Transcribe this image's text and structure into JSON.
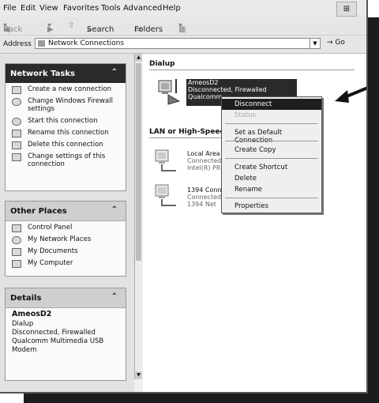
{
  "menubar": {
    "items": [
      "File",
      "Edit",
      "View",
      "Favorites",
      "Tools",
      "Advanced",
      "Help"
    ]
  },
  "toolbar": {
    "back": "Back",
    "search": "Search",
    "folders": "Folders"
  },
  "address": {
    "label": "Address",
    "value": "Network Connections",
    "go": "Go"
  },
  "network_tasks": {
    "title": "Network Tasks",
    "items": [
      "Create a new connection",
      "Change Windows Firewall settings",
      "Start this connection",
      "Rename this connection",
      "Delete this connection",
      "Change settings of this connection"
    ]
  },
  "other_places": {
    "title": "Other Places",
    "items": [
      "Control Panel",
      "My Network Places",
      "My Documents",
      "My Computer"
    ]
  },
  "details": {
    "title": "Details",
    "name": "AmeosD2",
    "lines": [
      "Dialup",
      "Disconnected, Firewalled",
      "Qualcomm Multimedia USB Modem"
    ]
  },
  "content": {
    "group_dialup": "Dialup",
    "group_lan": "LAN or High-Speed",
    "dialup_conn": {
      "name": "AmeosD2",
      "line2": "Disconnected, Firewalled",
      "line3": "Qualcomm"
    },
    "lan_conn1": {
      "name": "Local Area",
      "line2": "Connected",
      "line3": "Intel(R) PR"
    },
    "lan_conn2": {
      "name": "1394 Conn",
      "line2": "Connected",
      "line3": "1394 Net"
    }
  },
  "context_menu": {
    "items": [
      "Disconnect",
      "Status",
      "Set as Default Connection",
      "Create Copy",
      "Create Shortcut",
      "Delete",
      "Rename",
      "Properties"
    ]
  }
}
